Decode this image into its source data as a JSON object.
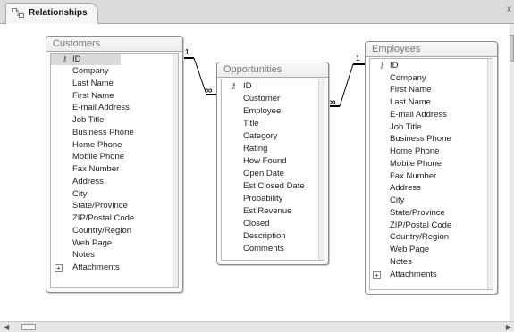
{
  "tab": {
    "label": "Relationships",
    "close": "x"
  },
  "tables": {
    "customers": {
      "title": "Customers",
      "fields": [
        "ID",
        "Company",
        "Last Name",
        "First Name",
        "E-mail Address",
        "Job Title",
        "Business Phone",
        "Home Phone",
        "Mobile Phone",
        "Fax Number",
        "Address",
        "City",
        "State/Province",
        "ZIP/Postal Code",
        "Country/Region",
        "Web Page",
        "Notes",
        "Attachments"
      ]
    },
    "opportunities": {
      "title": "Opportunities",
      "fields": [
        "ID",
        "Customer",
        "Employee",
        "Title",
        "Category",
        "Rating",
        "How Found",
        "Open Date",
        "Est Closed Date",
        "Probability",
        "Est Revenue",
        "Closed",
        "Description",
        "Comments"
      ]
    },
    "employees": {
      "title": "Employees",
      "fields": [
        "ID",
        "Company",
        "First Name",
        "Last Name",
        "E-mail Address",
        "Job Title",
        "Business Phone",
        "Home Phone",
        "Mobile Phone",
        "Fax Number",
        "Address",
        "City",
        "State/Province",
        "ZIP/Postal Code",
        "Country/Region",
        "Web Page",
        "Notes",
        "Attachments"
      ]
    }
  },
  "relationships": [
    {
      "one_side": "1",
      "many_side": "∞"
    },
    {
      "one_side": "1",
      "many_side": "∞"
    }
  ],
  "icons": {
    "primary_key": "key-icon",
    "expand": "plus-expander-icon"
  }
}
